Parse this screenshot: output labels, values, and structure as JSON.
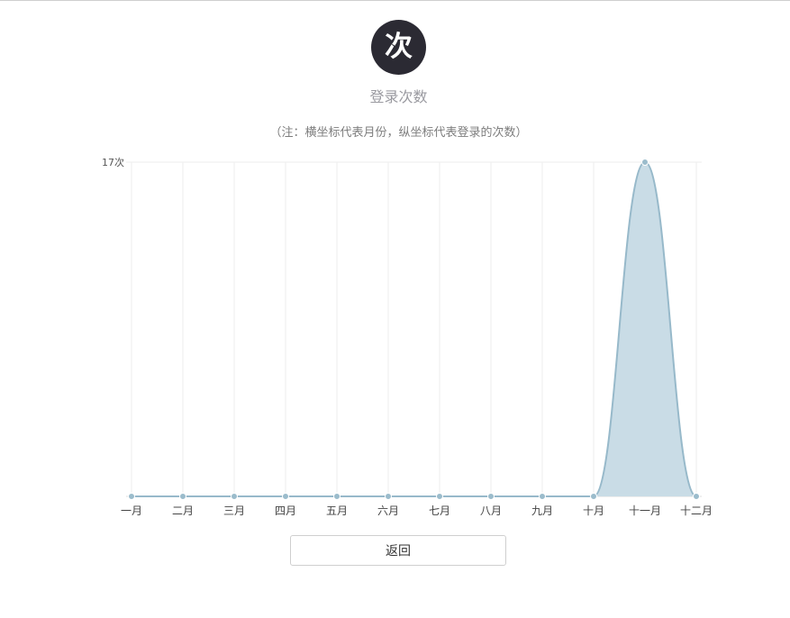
{
  "header": {
    "badge_char": "次",
    "title": "登录次数",
    "note": "（注：横坐标代表月份，纵坐标代表登录的次数）"
  },
  "chart_data": {
    "type": "area",
    "categories": [
      "一月",
      "二月",
      "三月",
      "四月",
      "五月",
      "六月",
      "七月",
      "八月",
      "九月",
      "十月",
      "十一月",
      "十二月"
    ],
    "values": [
      0,
      0,
      0,
      0,
      0,
      0,
      0,
      0,
      0,
      0,
      17,
      0
    ],
    "y_max_label": "17次",
    "ylim": [
      0,
      17
    ],
    "grid": true,
    "colors": {
      "line": "#97b9ca",
      "fill": "#c9dce6",
      "point": "#9bbccc",
      "grid": "#eeeeee",
      "axis": "#dddddd"
    }
  },
  "actions": {
    "back_label": "返回"
  }
}
